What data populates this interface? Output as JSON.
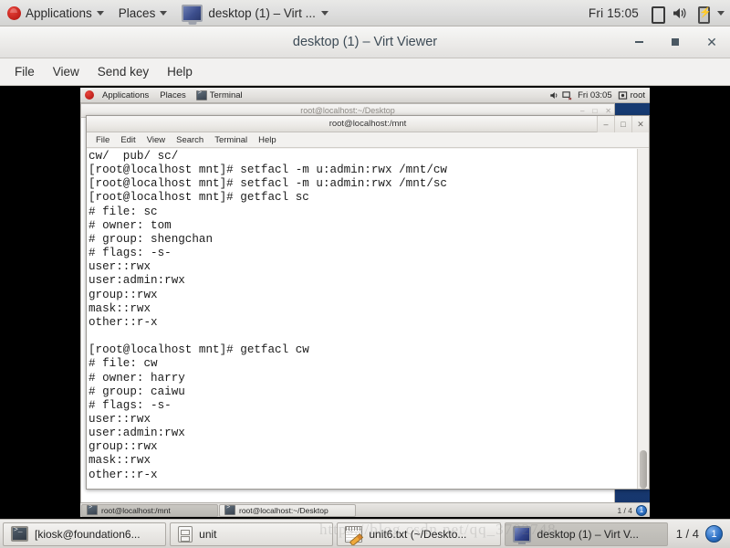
{
  "host_panel": {
    "applications_label": "Applications",
    "places_label": "Places",
    "window_task_label": "desktop (1) – Virt ...",
    "clock": "Fri 15:05",
    "icons": [
      "fedora-logo-icon",
      "chevron-down-icon",
      "screen-icon",
      "volume-icon",
      "battery-icon",
      "chevron-down-icon"
    ]
  },
  "virt_viewer": {
    "title": "desktop (1) – Virt Viewer",
    "window_buttons": {
      "minimize": "minimize-icon",
      "maximize": "maximize-icon",
      "close": "close-icon"
    },
    "menu": [
      "File",
      "View",
      "Send key",
      "Help"
    ]
  },
  "guest": {
    "panel": {
      "applications_label": "Applications",
      "places_label": "Places",
      "task_label": "Terminal",
      "clock": "Fri 03:05",
      "user": "root"
    },
    "background_window": {
      "title": "root@localhost:~/Desktop"
    },
    "terminal": {
      "title": "root@localhost:/mnt",
      "menu": [
        "File",
        "Edit",
        "View",
        "Search",
        "Terminal",
        "Help"
      ],
      "content": "cw/  pub/ sc/\n[root@localhost mnt]# setfacl -m u:admin:rwx /mnt/cw\n[root@localhost mnt]# setfacl -m u:admin:rwx /mnt/sc\n[root@localhost mnt]# getfacl sc\n# file: sc\n# owner: tom\n# group: shengchan\n# flags: -s-\nuser::rwx\nuser:admin:rwx\ngroup::rwx\nmask::rwx\nother::r-x\n\n[root@localhost mnt]# getfacl cw\n# file: cw\n# owner: harry\n# group: caiwu\n# flags: -s-\nuser::rwx\nuser:admin:rwx\ngroup::rwx\nmask::rwx\nother::r-x"
    },
    "taskbar": {
      "items": [
        {
          "label": "root@localhost:/mnt",
          "active": true
        },
        {
          "label": "root@localhost:~/Desktop",
          "active": false
        }
      ],
      "pager": "1 / 4",
      "badge": "1"
    }
  },
  "host_taskbar": {
    "items": [
      {
        "label": "[kiosk@foundation6...",
        "icon": "terminal-icon",
        "active": false
      },
      {
        "label": "unit",
        "icon": "archive-icon",
        "active": false
      },
      {
        "label": "unit6.txt (~/Deskto...",
        "icon": "text-editor-icon",
        "active": false
      },
      {
        "label": "desktop (1) – Virt V...",
        "icon": "virt-viewer-icon",
        "active": true
      }
    ],
    "pager": "1 / 4",
    "badge": "1"
  },
  "watermark": "https://blog.csdn.net/qq_3702748"
}
